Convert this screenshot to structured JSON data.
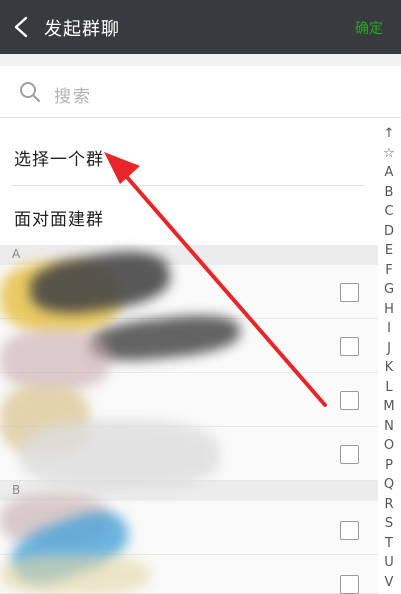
{
  "header": {
    "title": "发起群聊",
    "confirm_label": "确定"
  },
  "search": {
    "placeholder": "搜索"
  },
  "options": [
    {
      "label": "选择一个群"
    },
    {
      "label": "面对面建群"
    }
  ],
  "sections": [
    {
      "letter": "A"
    },
    {
      "letter": "B"
    }
  ],
  "index_bar": [
    "↑",
    "☆",
    "A",
    "B",
    "C",
    "D",
    "E",
    "F",
    "G",
    "H",
    "I",
    "J",
    "K",
    "L",
    "M",
    "N",
    "O",
    "P",
    "Q",
    "R",
    "S",
    "T",
    "U",
    "V"
  ],
  "colors": {
    "titlebar": "#393a3f",
    "confirm": "#1aad19",
    "arrow": "#e8262a"
  }
}
